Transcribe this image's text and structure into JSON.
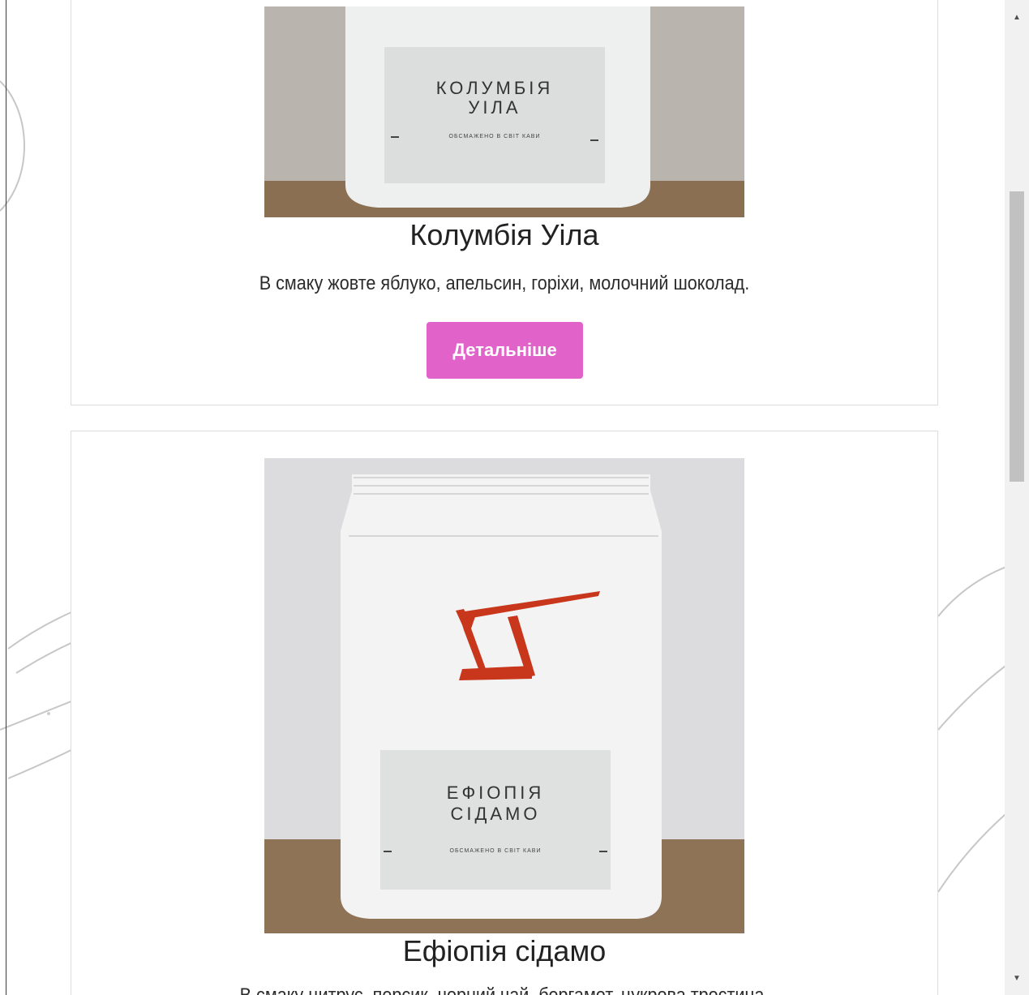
{
  "products": [
    {
      "title": "Колумбія Уіла",
      "description": "В смаку жовте яблуко, апельсин, горіхи, молочний шоколад.",
      "button_label": "Детальніше",
      "bag_name_line1": "КОЛУМБІЯ",
      "bag_name_line2": "УІЛА",
      "bag_subtitle": "ОБСМАЖЕНО В СВІТ КАВИ"
    },
    {
      "title": "Ефіопія сідамо",
      "description": "В смаку цитрус, персик, чорний чай, бергамот, цукрова тростина.",
      "bag_name_line1": "ЕФІОПІЯ",
      "bag_name_line2": "СІДАМО",
      "bag_subtitle": "ОБСМАЖЕНО В СВІТ КАВИ"
    }
  ],
  "colors": {
    "button": "#e162c9",
    "logo_red": "#c8361b"
  },
  "icons": {
    "scroll_up": "triangle-up",
    "scroll_down": "triangle-down"
  }
}
